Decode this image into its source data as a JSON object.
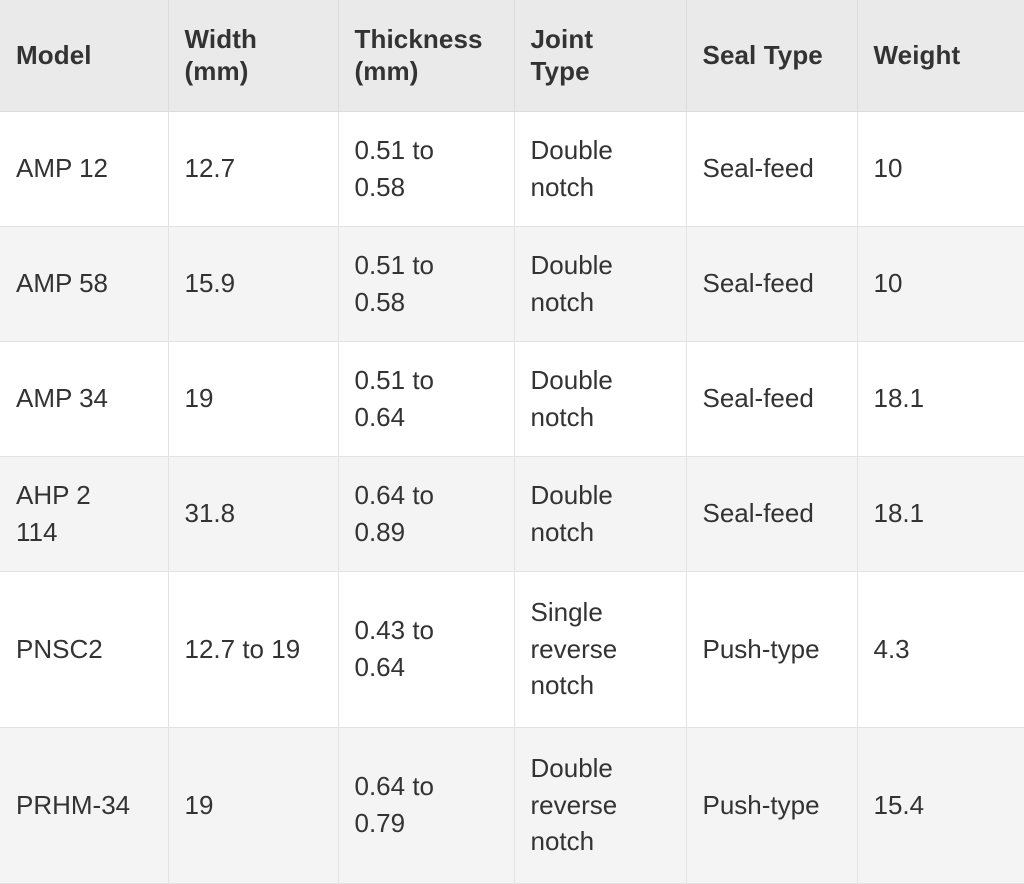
{
  "table": {
    "caption": "",
    "columns": [
      {
        "key": "model",
        "label": "Model"
      },
      {
        "key": "width",
        "label": "Width\n(mm)"
      },
      {
        "key": "thickness",
        "label": "Thickness\n(mm)"
      },
      {
        "key": "joint_type",
        "label": "Joint\nType"
      },
      {
        "key": "seal_type",
        "label": "Seal Type"
      },
      {
        "key": "weight",
        "label": "Weight"
      }
    ],
    "rows": [
      {
        "model": "AMP 12",
        "width": "12.7",
        "thickness": "0.51 to\n0.58",
        "joint_type": "Double\nnotch",
        "seal_type": "Seal-feed",
        "weight": "10"
      },
      {
        "model": "AMP 58",
        "width": "15.9",
        "thickness": "0.51 to\n0.58",
        "joint_type": "Double\nnotch",
        "seal_type": "Seal-feed",
        "weight": "10"
      },
      {
        "model": "AMP 34",
        "width": "19",
        "thickness": "0.51 to\n0.64",
        "joint_type": "Double\nnotch",
        "seal_type": "Seal-feed",
        "weight": "18.1"
      },
      {
        "model": "AHP 2\n114",
        "width": "31.8",
        "thickness": "0.64 to\n0.89",
        "joint_type": "Double\nnotch",
        "seal_type": "Seal-feed",
        "weight": "18.1"
      },
      {
        "model": "PNSC2",
        "width": "12.7 to 19",
        "thickness": "0.43 to\n0.64",
        "joint_type": "Single\nreverse\nnotch",
        "seal_type": "Push-type",
        "weight": "4.3"
      },
      {
        "model": "PRHM-34",
        "width": "19",
        "thickness": "0.64 to\n0.79",
        "joint_type": "Double\nreverse\nnotch",
        "seal_type": "Push-type",
        "weight": "15.4"
      }
    ]
  },
  "style": {
    "header_background": "#eaeaea",
    "stripe_background": "#f4f4f4",
    "base_background": "#ffffff",
    "text_color": "#333333",
    "border_color": "#e2e2e2"
  }
}
